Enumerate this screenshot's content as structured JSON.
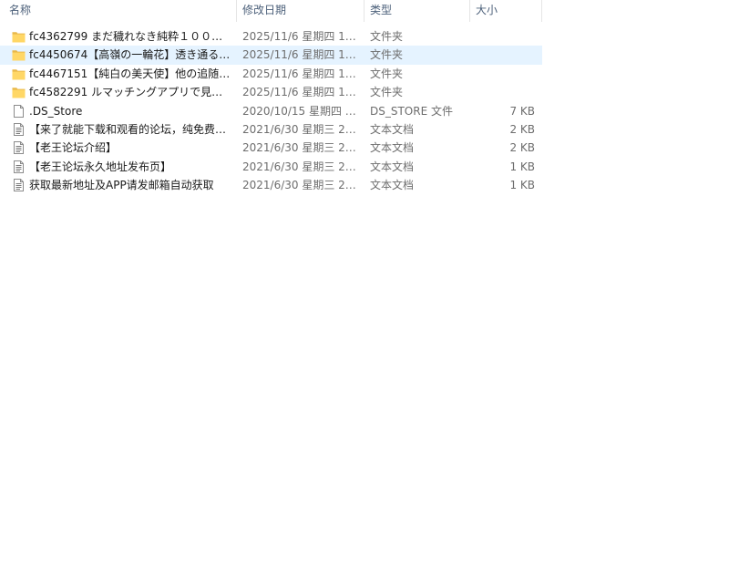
{
  "columns": {
    "name": "名称",
    "date": "修改日期",
    "type": "类型",
    "size": "大小"
  },
  "sort_caret": "^",
  "rows": [
    {
      "kind": "folder",
      "name": "fc4362799 まだ穢れなき純粋１００％...",
      "date": "2025/11/6 星期四 15:...",
      "type": "文件夹",
      "size": "",
      "selected": false
    },
    {
      "kind": "folder",
      "name": "fc4450674【高嶺の一輪花】透き通る瞳...",
      "date": "2025/11/6 星期四 15:...",
      "type": "文件夹",
      "size": "",
      "selected": true
    },
    {
      "kind": "folder",
      "name": "fc4467151【純白の美天使】他の追随を...",
      "date": "2025/11/6 星期四 15:...",
      "type": "文件夹",
      "size": "",
      "selected": false
    },
    {
      "kind": "folder",
      "name": "fc4582291 ルマッチングアプリで見つ...",
      "date": "2025/11/6 星期四 15:...",
      "type": "文件夹",
      "size": "",
      "selected": false
    },
    {
      "kind": "file",
      "name": ".DS_Store",
      "date": "2020/10/15 星期四 2...",
      "type": "DS_STORE 文件",
      "size": "7 KB",
      "selected": false
    },
    {
      "kind": "text",
      "name": "【来了就能下载和观看的论坛，纯免费！...",
      "date": "2021/6/30 星期三 22:...",
      "type": "文本文档",
      "size": "2 KB",
      "selected": false
    },
    {
      "kind": "text",
      "name": "【老王论坛介绍】",
      "date": "2021/6/30 星期三 22:...",
      "type": "文本文档",
      "size": "2 KB",
      "selected": false
    },
    {
      "kind": "text",
      "name": "【老王论坛永久地址发布页】",
      "date": "2021/6/30 星期三 22:...",
      "type": "文本文档",
      "size": "1 KB",
      "selected": false
    },
    {
      "kind": "text",
      "name": "获取最新地址及APP请发邮箱自动获取",
      "date": "2021/6/30 星期三 22:...",
      "type": "文本文档",
      "size": "1 KB",
      "selected": false
    }
  ],
  "colors": {
    "folder": "#ffd766",
    "folder_dark": "#e8b84a",
    "selected_bg": "#e5f3ff",
    "header_text": "#4c607a"
  }
}
